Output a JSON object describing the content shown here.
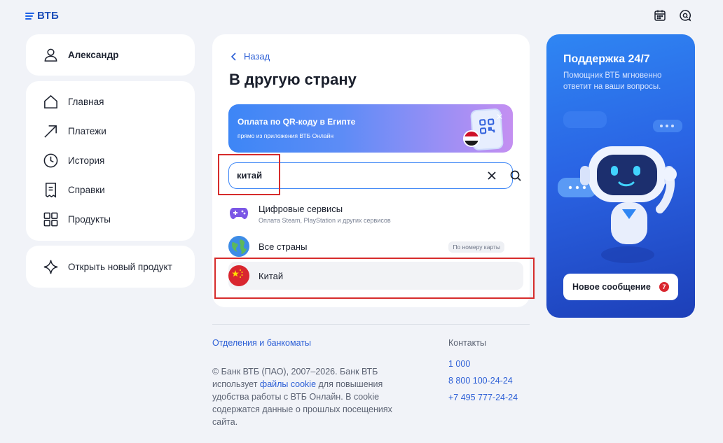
{
  "header": {
    "logo_text": "ВТБ",
    "icons": [
      "calendar-icon",
      "chat-search-icon"
    ]
  },
  "sidebar": {
    "user_name": "Александр",
    "items": [
      {
        "label": "Главная",
        "icon": "home-icon"
      },
      {
        "label": "Платежи",
        "icon": "arrow-up-right-icon"
      },
      {
        "label": "История",
        "icon": "clock-icon"
      },
      {
        "label": "Справки",
        "icon": "document-icon"
      },
      {
        "label": "Продукты",
        "icon": "grid-icon"
      }
    ],
    "new_product_label": "Открыть новый продукт"
  },
  "main": {
    "back_label": "Назад",
    "title": "В другую страну",
    "banner": {
      "title": "Оплата по QR-коду в Египте",
      "subtitle": "прямо из приложения ВТБ Онлайн"
    },
    "search": {
      "value": "китай"
    },
    "results": [
      {
        "title": "Цифровые сервисы",
        "subtitle": "Оплата Steam, PlayStation и других сервисов",
        "icon": "gamepad-icon"
      },
      {
        "title": "Все страны",
        "badge": "По номеру карты",
        "icon": "globe-icon"
      },
      {
        "title": "Китай",
        "icon": "china-flag-icon"
      }
    ]
  },
  "footer": {
    "branches_link": "Отделения и банкоматы",
    "copyright_pre": "© Банк ВТБ (ПАО), 2007–2026. Банк ВТБ использует ",
    "cookie_link": "файлы cookie",
    "copyright_post": " для повышения удобства работы с ВТБ Онлайн. В cookie содержатся данные о прошлых посещениях сайта.",
    "contacts_title": "Контакты",
    "phones": [
      "1 000",
      "8 800 100-24-24",
      "+7 495 777-24-24"
    ]
  },
  "promo": {
    "title": "Поддержка 24/7",
    "text": "Помощник ВТБ мгновенно ответит на ваши вопросы.",
    "button_label": "Новое сообщение",
    "badge_count": "7"
  },
  "colors": {
    "accent": "#2c5fd6",
    "highlight": "#d62c2c",
    "background": "#f1f3f8"
  }
}
